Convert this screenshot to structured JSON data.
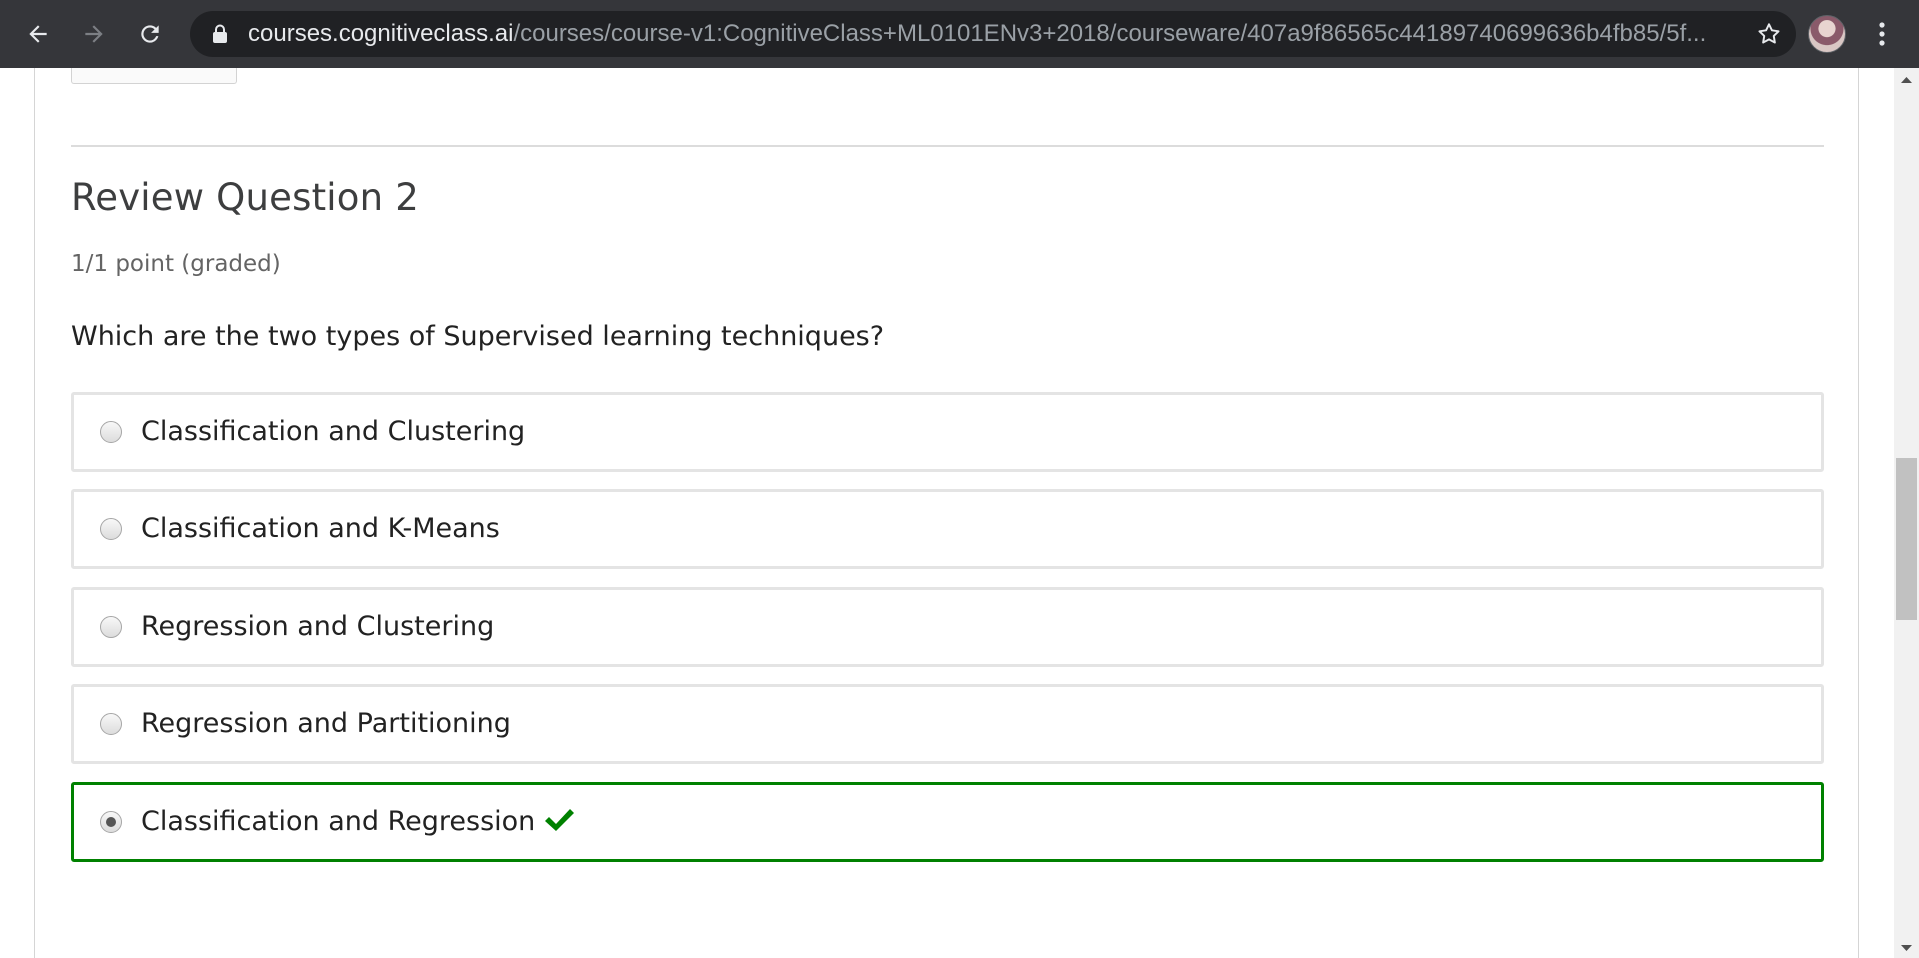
{
  "browser": {
    "url_host": "courses.cognitiveclass.ai",
    "url_path": "/courses/course-v1:CognitiveClass+ML0101ENv3+2018/courseware/407a9f86565c44189740699636b4fb85/5f..."
  },
  "question": {
    "title": "Review Question 2",
    "points": "1/1 point (graded)",
    "prompt": "Which are the two types of Supervised learning techniques?",
    "options": [
      {
        "label": "Classification and Clustering",
        "selected": false,
        "correct": false
      },
      {
        "label": "Classification and K-Means",
        "selected": false,
        "correct": false
      },
      {
        "label": "Regression and Clustering",
        "selected": false,
        "correct": false
      },
      {
        "label": "Regression and Partitioning",
        "selected": false,
        "correct": false
      },
      {
        "label": "Classification and Regression",
        "selected": true,
        "correct": true
      }
    ]
  },
  "colors": {
    "correct": "#008100",
    "chrome": "#35363a",
    "omnibox": "#202124"
  },
  "icons": [
    "back-arrow-icon",
    "forward-arrow-icon",
    "reload-icon",
    "lock-icon",
    "star-icon",
    "profile-avatar",
    "kebab-menu-icon",
    "checkmark-icon"
  ]
}
